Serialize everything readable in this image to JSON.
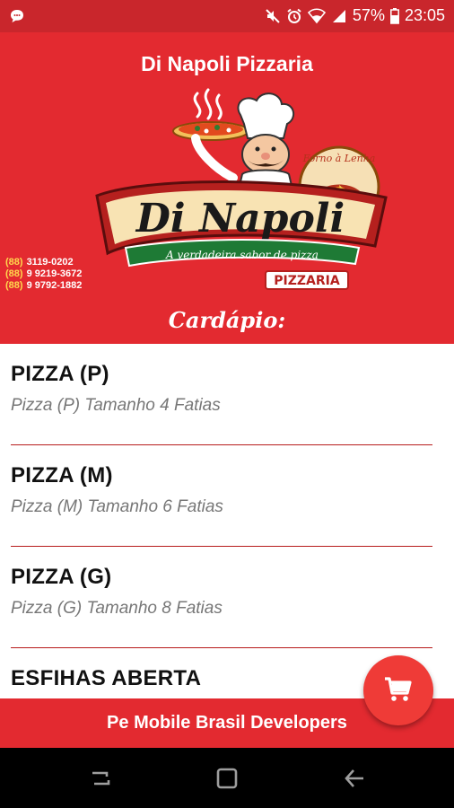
{
  "status_bar": {
    "battery": "57%",
    "time": "23:05",
    "icons": [
      "chat-icon",
      "mute-icon",
      "alarm-icon",
      "wifi-icon",
      "signal-icon",
      "battery-icon"
    ]
  },
  "header": {
    "title": "Di Napoli Pizzaria",
    "logo": {
      "name": "Di Napoli",
      "tagline": "A verdadeira sabor de pizza",
      "subtitle": "PIZZARIA",
      "badge": "Forno à Lenha"
    },
    "phones": [
      {
        "ddd": "(88)",
        "number": "3119-0202"
      },
      {
        "ddd": "(88)",
        "number": "9 9219-3672"
      },
      {
        "ddd": "(88)",
        "number": "9 9792-1882"
      }
    ],
    "section_label": "Cardápio:"
  },
  "menu": {
    "items": [
      {
        "title": "PIZZA (P)",
        "subtitle": "Pizza (P) Tamanho 4 Fatias"
      },
      {
        "title": "PIZZA (M)",
        "subtitle": "Pizza (M) Tamanho 6 Fatias"
      },
      {
        "title": "PIZZA (G)",
        "subtitle": "Pizza (G) Tamanho 8 Fatias"
      },
      {
        "title": "ESFIHAS ABERTA",
        "subtitle": ""
      }
    ]
  },
  "footer": {
    "label": "Pe Mobile Brasil Developers"
  },
  "fab": {
    "icon": "cart-icon"
  },
  "nav_bar": {
    "icons": [
      "recent-apps-icon",
      "home-icon",
      "back-icon"
    ]
  },
  "colors": {
    "primary": "#e32a30",
    "status_bar": "#c9262c",
    "fab": "#ef3b37",
    "divider": "#b71c1c"
  }
}
